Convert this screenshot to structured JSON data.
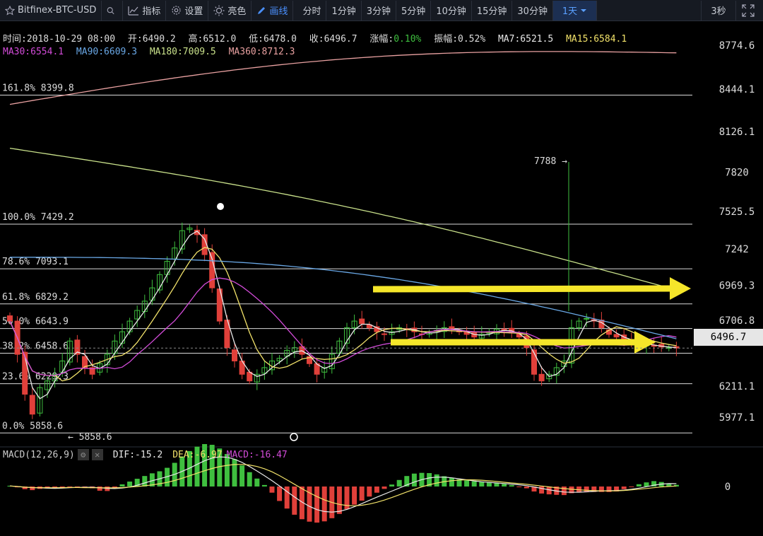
{
  "toolbar": {
    "symbol": "Bitfinex-BTC-USD",
    "indicators_label": "指标",
    "settings_label": "设置",
    "theme_label": "亮色",
    "draw_label": "画线",
    "intervals": [
      "分时",
      "1分钟",
      "3分钟",
      "5分钟",
      "10分钟",
      "15分钟",
      "30分钟"
    ],
    "selected_interval": "1天",
    "refresh": "3秒"
  },
  "info": {
    "time": "时间:2018-10-29 08:00",
    "open": "开:6490.2",
    "high": "高:6512.0",
    "low": "低:6478.0",
    "close": "收:6496.7",
    "change_label": "涨幅:",
    "change_value": "0.10%",
    "amplitude": "振幅:0.52%",
    "ma7": "MA7:6521.5",
    "ma15": "MA15:6584.1",
    "ma30": "MA30:6554.1",
    "ma90": "MA90:6609.3",
    "ma180": "MA180:7009.5",
    "ma360": "MA360:8712.3"
  },
  "colors": {
    "up": "#3fbf3f",
    "down": "#e0403a",
    "ma7": "#e8e8e8",
    "ma15": "#f2e26a",
    "ma30": "#d24bd8",
    "ma90": "#6aa8e6",
    "ma180": "#c8e08a",
    "ma360": "#e8a0a0",
    "arrow": "#f5e62a",
    "fib": "#ffffff"
  },
  "current_price": "6496.7",
  "annotations": {
    "peak": "7788",
    "low_label": "5858.6"
  },
  "macd": {
    "title": "MACD(12,26,9)",
    "dif": "DIF:-15.2",
    "dea": "DEA:-6.97",
    "macd": "MACD:-16.47"
  },
  "chart_data": {
    "type": "candlestick",
    "title": "Bitfinex-BTC-USD 1天",
    "ylim": [
      5858.6,
      8774.6
    ],
    "price_ticks": [
      "8774.6",
      "8444.1",
      "8126.1",
      "7820",
      "7525.5",
      "7242",
      "6969.3",
      "6706.8",
      "6211.1",
      "5977.1"
    ],
    "price_tick_values": [
      8774.6,
      8444.1,
      8126.1,
      7820,
      7525.5,
      7242,
      6969.3,
      6706.8,
      6211.1,
      5977.1
    ],
    "fib_levels": [
      {
        "label": "161.8% 8399.8",
        "value": 8399.8
      },
      {
        "label": "100.0% 7429.2",
        "value": 7429.2
      },
      {
        "label": "78.6% 7093.1",
        "value": 7093.1
      },
      {
        "label": "61.8% 6829.2",
        "value": 6829.2
      },
      {
        "label": "50.0% 6643.9",
        "value": 6643.9
      },
      {
        "label": "38.2% 6458.6",
        "value": 6458.6
      },
      {
        "label": "23.6% 6229.3",
        "value": 6229.3
      },
      {
        "label": "0.0% 5858.6",
        "value": 5858.6
      }
    ],
    "close_series": [
      6700,
      6450,
      6150,
      6000,
      6200,
      6250,
      6300,
      6400,
      6550,
      6450,
      6350,
      6300,
      6380,
      6450,
      6550,
      6620,
      6700,
      6780,
      6850,
      6950,
      7050,
      7150,
      7250,
      7380,
      7400,
      7350,
      7200,
      6950,
      6700,
      6500,
      6400,
      6300,
      6250,
      6300,
      6350,
      6400,
      6420,
      6480,
      6500,
      6450,
      6380,
      6300,
      6350,
      6450,
      6550,
      6650,
      6700,
      6680,
      6650,
      6620,
      6600,
      6620,
      6650,
      6640,
      6620,
      6600,
      6610,
      6630,
      6650,
      6640,
      6620,
      6600,
      6580,
      6600,
      6620,
      6640,
      6630,
      6610,
      6580,
      6500,
      6300,
      6250,
      6300,
      6350,
      6400,
      6650,
      6700,
      6720,
      6700,
      6650,
      6600,
      6580,
      6560,
      6540,
      6530,
      6520,
      6510,
      6505,
      6500,
      6497
    ]
  }
}
